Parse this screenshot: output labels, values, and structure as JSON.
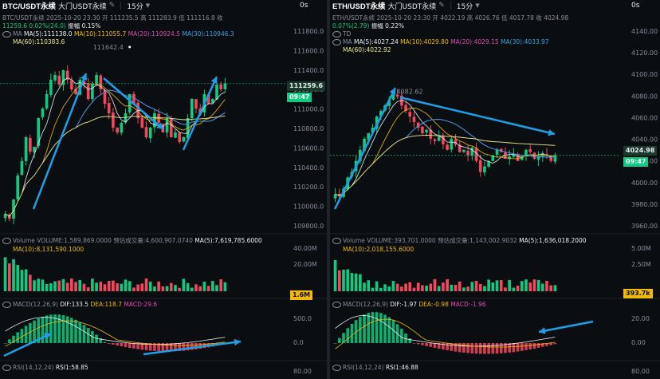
{
  "colors": {
    "up": "#0ecb81",
    "down": "#f6465d",
    "ma5": "#eaecef",
    "ma10": "#f0b90b",
    "ma20": "#e04ab4",
    "ma30": "#2ea3e8",
    "ma60": "#f0e68c",
    "annotation": "#1e9fe8",
    "background": "#0b0e11"
  },
  "btc": {
    "symbol": "BTC/USDT永续",
    "timeframe": "15分",
    "zoom_label": "0s",
    "info1": "BTC/USDT永续  2025-10-20 23:30  开 111235.5  高 111283.9  低 111116.8  收",
    "info2_a": "11259.6",
    "info2_b": "0.02%(24.0)",
    "info2_c": "振幅 0.15%",
    "ma_line": {
      "ma5": "MA(5):111138.0",
      "ma10": "MA(10):111055.7",
      "ma20": "MA(20):110924.5",
      "ma30": "MA(30):110946.3",
      "ma60": "MA(60):110383.6",
      "label": "MA"
    },
    "high_annot": "111642.4",
    "price_axis": [
      "111800.0",
      "111600.0",
      "111400.0",
      "111200.0",
      "111000.0",
      "110800.0",
      "110600.0",
      "110400.0",
      "110200.0",
      "110000.0",
      "109800.0"
    ],
    "last_price": "111259.6",
    "countdown": "09:47",
    "volume": {
      "line": "Volume  VOLUME:1,589,869.0000  预估成交量:4,600,907.0740",
      "ma5": "MA(5):7,619,785.6000",
      "ma10": "MA(10):8,131,590.1000",
      "axis": [
        "40.00M",
        "20.00M"
      ],
      "current": "1.6M"
    },
    "macd": {
      "label": "MACD(12,26,9)",
      "dif": "DIF:133.5",
      "dea": "DEA:118.7",
      "macd": "MACD:29.6",
      "axis": [
        "500.0",
        "0.0"
      ]
    },
    "rsi": {
      "label": "RSI(14,12,24)",
      "rsi1": "RSI1:58.85",
      "axis": "80.00"
    }
  },
  "eth": {
    "symbol": "ETH/USDT永续",
    "timeframe": "15分",
    "zoom_label": "0s",
    "info1": "ETH/USDT永续  2025-10-20 23:30  开 4022.19  高 4026.76  低 4017.78  收 4024.98",
    "info2_b": "0.07%(2.79)",
    "info2_c": "振幅 0.22%",
    "ma_line": {
      "label": "MA",
      "ma5": "MA(5):4027.24",
      "ma10": "MA(10):4029.80",
      "ma20": "MA(20):4029.15",
      "ma30": "MA(30):4033.97",
      "ma60": "MA(60):4022.92"
    },
    "td_label": "TD",
    "high_annot": "4082.62",
    "price_axis": [
      "4140.00",
      "4120.00",
      "4100.00",
      "4080.00",
      "4060.00",
      "4040.00",
      "4020.00",
      "4000.00",
      "3980.00",
      "3960.00"
    ],
    "last_price": "4024.98",
    "countdown": "09:47",
    "volume": {
      "line": "Volume  VOLUME:393,701.0000  预估成交量:1,143,002.9032",
      "ma5": "MA(5):1,636,018.2000",
      "ma10": "MA(10):2,018,155.6000",
      "axis": [
        "5.00M",
        "2.50M"
      ],
      "current": "393.7k"
    },
    "macd": {
      "label": "MACD(12,26,9)",
      "dif": "DIF:-1.97",
      "dea": "DEA:-0.98",
      "macd": "MACD:-1.96",
      "axis": [
        "20.00",
        "0.00"
      ]
    },
    "rsi": {
      "label": "RSI(14,12,24)",
      "rsi1": "RSI1:46.88",
      "axis": "80.00"
    }
  },
  "chart_data": [
    {
      "type": "candlestick",
      "title": "BTC/USDT永续 15分",
      "ylim": [
        109700,
        111900
      ],
      "close": [
        109900,
        109850,
        110050,
        110300,
        110450,
        110700,
        110550,
        110600,
        110900,
        111000,
        111150,
        111300,
        111350,
        111250,
        111400,
        111300,
        111200,
        111150,
        111300,
        111250,
        111100,
        111250,
        111350,
        111200,
        111050,
        110950,
        110800,
        110750,
        110850,
        110950,
        111150,
        111050,
        110900,
        110800,
        110700,
        110800,
        110950,
        110850,
        110750,
        110900,
        110700,
        110750,
        110650,
        110700,
        110900,
        111100,
        111000,
        110950,
        111150,
        111050,
        111100,
        111250,
        111200,
        111260
      ],
      "annotations": [
        {
          "label": "111642.4",
          "x": 30,
          "y": 111642.4
        }
      ]
    },
    {
      "type": "candlestick",
      "title": "ETH/USDT永续 15分",
      "ylim": [
        3955,
        4145
      ],
      "close": [
        3990,
        3988,
        3995,
        4005,
        4010,
        4020,
        4030,
        4040,
        4045,
        4050,
        4060,
        4065,
        4070,
        4075,
        4080,
        4078,
        4070,
        4065,
        4060,
        4055,
        4050,
        4045,
        4048,
        4040,
        4038,
        4042,
        4035,
        4030,
        4040,
        4035,
        4028,
        4030,
        4025,
        4032,
        4020,
        4010,
        4015,
        4020,
        4025,
        4030,
        4028,
        4022,
        4024,
        4026,
        4020,
        4024,
        4030,
        4028,
        4022,
        4024,
        4027,
        4025,
        4020,
        4025
      ],
      "annotations": [
        {
          "label": "4082.62",
          "x": 14,
          "y": 4082.62
        }
      ]
    }
  ]
}
